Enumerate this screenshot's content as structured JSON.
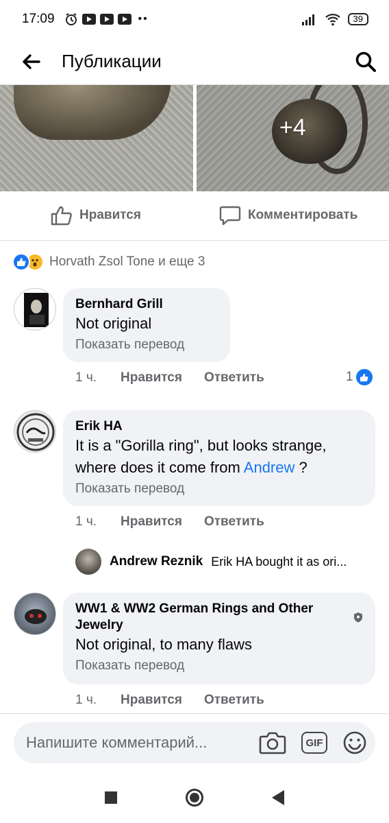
{
  "status_bar": {
    "time": "17:09",
    "battery": "39"
  },
  "header": {
    "title": "Публикации",
    "back_icon": "arrow-left-icon",
    "search_icon": "search-icon"
  },
  "photos": {
    "more_count": "+4"
  },
  "actions": {
    "like": "Нравится",
    "comment": "Комментировать"
  },
  "reactions": {
    "text": "Horvath Zsol Tone и еще 3",
    "icons": [
      "like-icon",
      "wow-icon"
    ]
  },
  "comments": [
    {
      "name": "Bernhard Grill",
      "text": "Not original",
      "translate": "Показать перевод",
      "time": "1 ч.",
      "like": "Нравится",
      "reply": "Ответить",
      "like_count": "1"
    },
    {
      "name": "Erik HA",
      "text_line1": "It is a \"Gorilla ring\", but looks strange,",
      "text_line2_pre": "where does it come from ",
      "mention": "Andrew",
      "text_line2_post": " ?",
      "translate": "Показать перевод",
      "time": "1 ч.",
      "like": "Нравится",
      "reply": "Ответить"
    },
    {
      "name_line1": "WW1 & WW2 German Rings and Other",
      "name_line2": "Jewelry",
      "text": "Not original, to many flaws",
      "translate": "Показать перевод",
      "time": "1 ч.",
      "like": "Нравится",
      "reply": "Ответить"
    }
  ],
  "reply_preview": {
    "name": "Andrew Reznik",
    "text": "Erik HA bought it as ori..."
  },
  "composer": {
    "placeholder": "Напишите комментарий...",
    "gif_label": "GIF"
  },
  "colors": {
    "accent": "#1877f2",
    "bubble": "#f0f2f5",
    "secondary_text": "#65676b"
  }
}
